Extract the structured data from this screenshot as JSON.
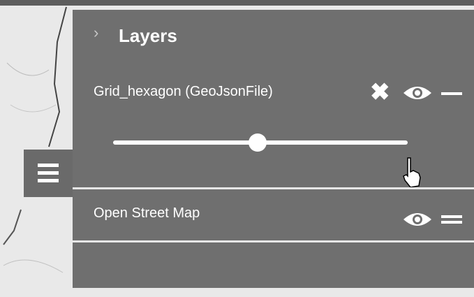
{
  "panel": {
    "title": "Layers",
    "layers": [
      {
        "name": "Grid_hexagon (GeoJsonFile)",
        "opacity": 0.49,
        "icons": [
          "close-icon",
          "eye-icon",
          "minus-icon"
        ]
      },
      {
        "name": "Open Street Map",
        "icons": [
          "eye-icon",
          "equals-icon"
        ]
      }
    ]
  },
  "icons": {
    "chevron": "›",
    "close": "✖"
  }
}
